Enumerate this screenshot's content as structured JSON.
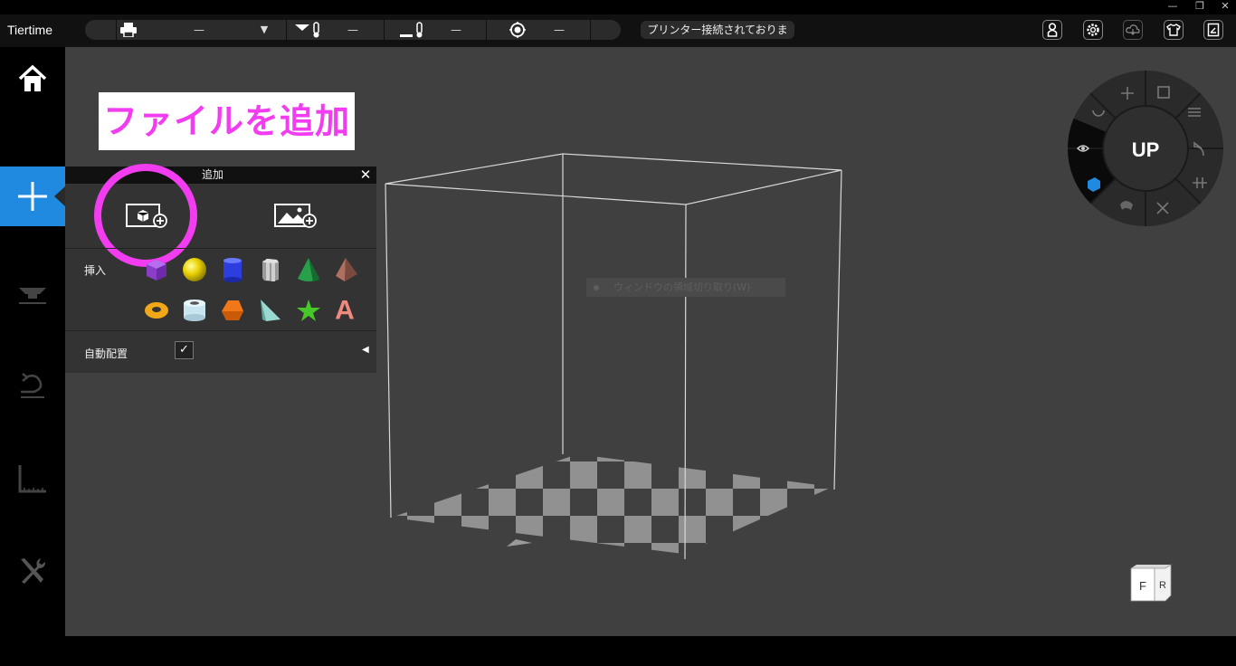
{
  "window": {
    "minimize": "—",
    "restore": "❐",
    "close": "✕"
  },
  "app": {
    "logo": "Tiertime"
  },
  "toolbar": {
    "printer_value": "—",
    "nozzle_temp": "—",
    "bed_temp": "—",
    "position_value": "—",
    "connection_status": "プリンター接続されておりま"
  },
  "annotation": {
    "text": "ファイルを追加"
  },
  "add_panel": {
    "title": "追加",
    "close": "✕",
    "insert_label": "挿入",
    "autoplace_label": "自動配置",
    "autoplace_checked": "✓",
    "collapse": "◀",
    "shapes": [
      "cube",
      "sphere",
      "cylinder",
      "hex-prism",
      "cone",
      "pyramid",
      "torus",
      "tube",
      "pentagon-prism",
      "wedge",
      "star",
      "text-A"
    ],
    "text_shape_letter": "A"
  },
  "viewport": {
    "tooltip": "ウィンドウの領域切り取り(W)"
  },
  "nav_wheel": {
    "logo": "UP"
  },
  "view_cube": {
    "front": "F",
    "right": "R"
  },
  "colors": {
    "accent": "#1f8ae0",
    "highlight": "#f23cf0",
    "viewport": "#404040"
  }
}
